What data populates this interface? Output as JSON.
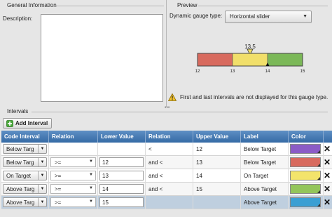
{
  "general": {
    "title": "General Information",
    "description_label": "Description:",
    "description_value": ""
  },
  "preview": {
    "title": "Preview",
    "gauge_type_label": "Dynamic gauge type:",
    "gauge_type_value": "Horizontal slider",
    "gauge": {
      "marker_label": "13.5",
      "marker_value": 13.5,
      "min": 12,
      "max": 15,
      "ticks": [
        "12",
        "13",
        "14",
        "15"
      ],
      "bands": [
        {
          "from": 12,
          "to": 13,
          "color": "#d86a5e"
        },
        {
          "from": 13,
          "to": 14,
          "color": "#f1df6a"
        },
        {
          "from": 14,
          "to": 15,
          "color": "#7bb858"
        }
      ]
    },
    "warning_text": "First and last intervals are not displayed for this gauge type."
  },
  "intervals": {
    "title": "Intervals",
    "add_button_label": "Add Interval",
    "columns": [
      "Code Interval",
      "Relation",
      "Lower Value",
      "Relation",
      "Upper Value",
      "Label",
      "Color"
    ],
    "rows": [
      {
        "code": "Below Targ",
        "relation1": "",
        "lower": "",
        "relation2": "<",
        "upper": "12",
        "label": "Below Target",
        "color": "#8b5cc6"
      },
      {
        "code": "Below Targ",
        "relation1": ">=",
        "lower": "12",
        "relation2": "and <",
        "upper": "13",
        "label": "Below Target",
        "color": "#d86a5e"
      },
      {
        "code": "On Target",
        "relation1": ">=",
        "lower": "13",
        "relation2": "and <",
        "upper": "14",
        "label": "On Target",
        "color": "#f3e46b"
      },
      {
        "code": "Above Targ",
        "relation1": ">=",
        "lower": "14",
        "relation2": "and <",
        "upper": "15",
        "label": "Above Target",
        "color": "#93c55a"
      },
      {
        "code": "Above Targ",
        "relation1": ">=",
        "lower": "15",
        "relation2": "",
        "upper": "",
        "label": "Above Target",
        "color": "#3a9fd3"
      }
    ]
  }
}
